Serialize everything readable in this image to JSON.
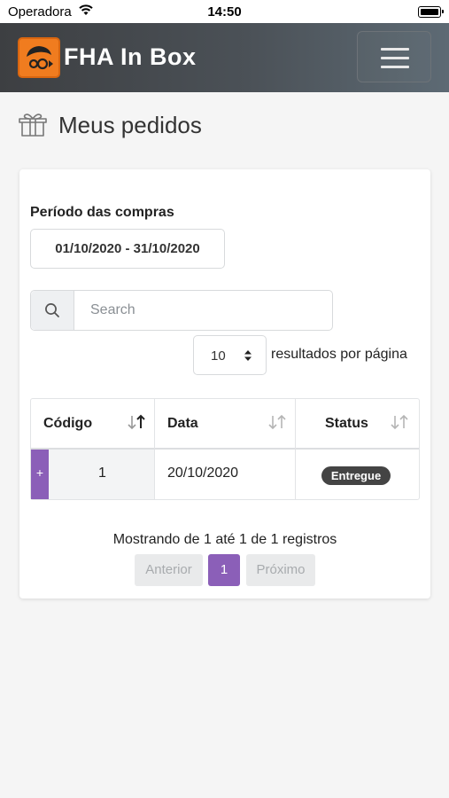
{
  "status_bar": {
    "carrier": "Operadora",
    "time": "14:50"
  },
  "navbar": {
    "brand": "FHA In Box"
  },
  "page": {
    "title": "Meus pedidos"
  },
  "filters": {
    "period_label": "Período das compras",
    "period_value": "01/10/2020 - 31/10/2020",
    "search_placeholder": "Search",
    "per_page_value": "10",
    "per_page_label": "resultados por página"
  },
  "table": {
    "columns": [
      "Código",
      "Data",
      "Status"
    ],
    "rows": [
      {
        "expand": "+",
        "codigo": "1",
        "data": "20/10/2020",
        "status": "Entregue"
      }
    ]
  },
  "pagination": {
    "info": "Mostrando de 1 até 1 de 1 registros",
    "prev_label": "Anterior",
    "current_page": "1",
    "next_label": "Próximo"
  },
  "colors": {
    "accent": "#8b5fb8",
    "navbar": "#4b5157",
    "logo": "#f07c1f",
    "badge": "#444444"
  }
}
